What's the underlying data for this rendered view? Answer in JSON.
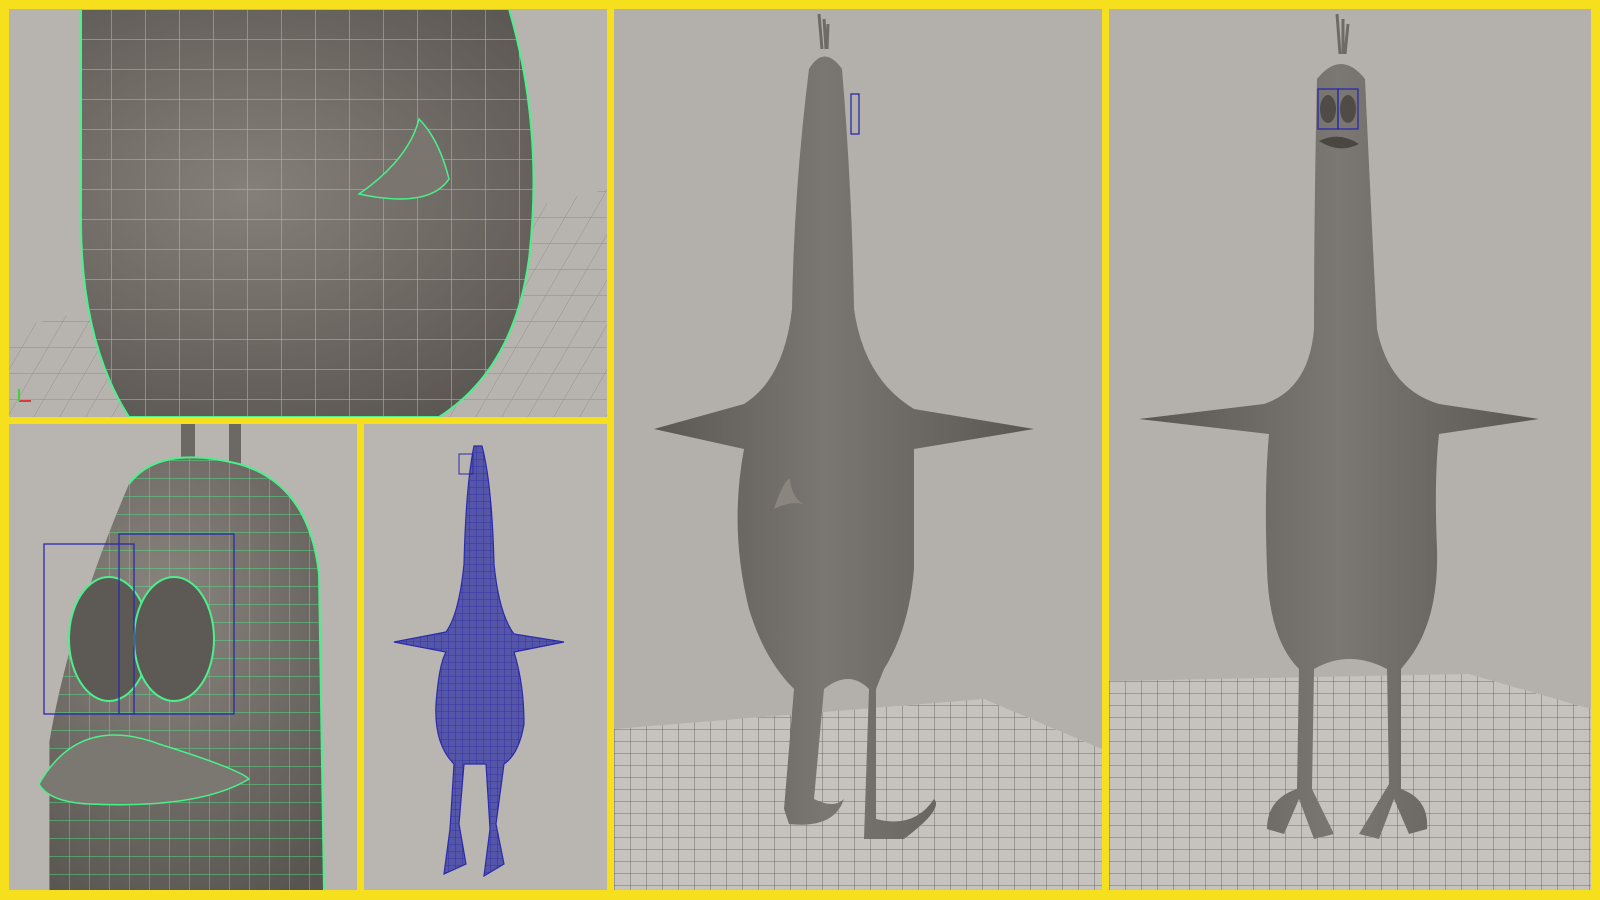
{
  "layout_description_free": true,
  "background_color": "#f6df1c",
  "viewport_bg_color": "#b9b6b2",
  "model_color": "#6f6b67",
  "wire_green": "#4cf08a",
  "wire_blue": "#2a2aa8",
  "viewports": [
    {
      "id": "closeup-body-wireframe",
      "shading": "wireframe-on-shaded"
    },
    {
      "id": "closeup-head-wireframe",
      "shading": "wireframe-on-shaded"
    },
    {
      "id": "full-body-wireframe-selected",
      "shading": "wireframe-selected"
    },
    {
      "id": "perspective-three-quarter",
      "shading": "smooth-shaded"
    },
    {
      "id": "perspective-front",
      "shading": "smooth-shaded"
    }
  ]
}
